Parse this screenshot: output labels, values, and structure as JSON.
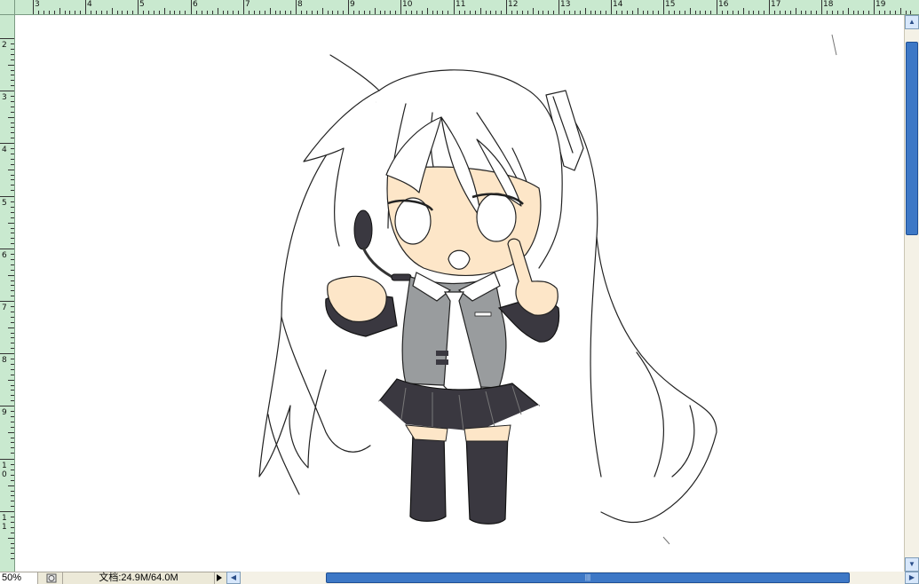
{
  "ruler_top": {
    "labels": [
      "3",
      "4",
      "5",
      "6",
      "7",
      "8",
      "9",
      "10",
      "11",
      "12",
      "13",
      "14",
      "15",
      "16",
      "17",
      "18",
      "19"
    ]
  },
  "ruler_left": {
    "labels": [
      "2",
      "3",
      "4",
      "5",
      "6",
      "7",
      "8",
      "9",
      "10",
      "11"
    ]
  },
  "status": {
    "zoom": "50%",
    "doc_info": "文档:24.9M/64.0M"
  },
  "icons": {
    "status_button": "document-info-icon",
    "play": "triangle-right-icon",
    "scroll_left": "arrow-left-icon",
    "scroll_right": "arrow-right-icon",
    "scroll_up": "arrow-up-icon",
    "scroll_down": "arrow-down-icon"
  },
  "colors": {
    "ruler": "#c9e9cf",
    "scroll_thumb": "#3d78c6",
    "skin": "#fde6c8",
    "vest": "#999c9e",
    "dark": "#3a3840"
  }
}
